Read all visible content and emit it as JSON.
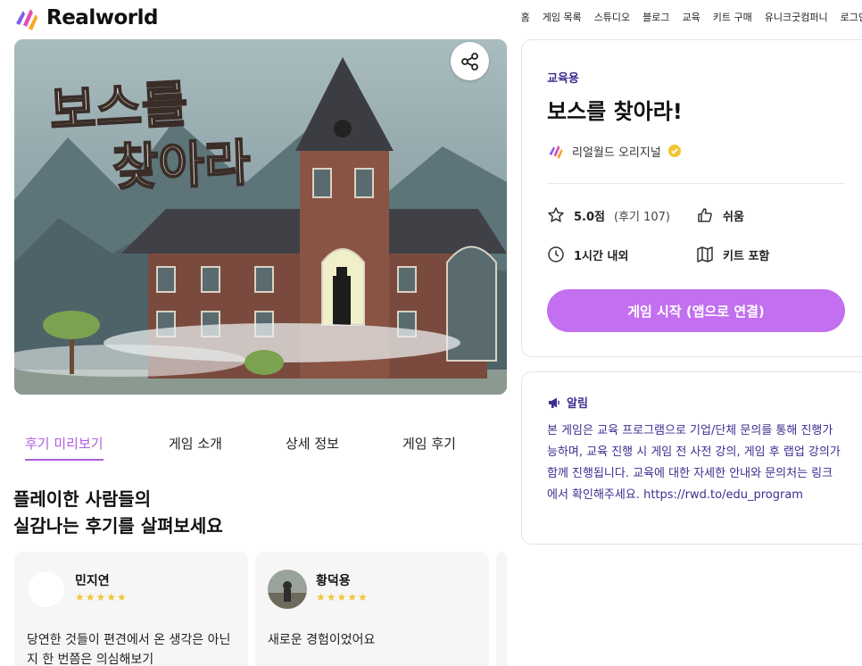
{
  "header": {
    "logo_text": "Realworld",
    "nav": [
      "홈",
      "게임 목록",
      "스튜디오",
      "블로그",
      "교육",
      "키트 구매",
      "유니크굿컴퍼니",
      "로그인"
    ]
  },
  "hero": {
    "title_line1": "보스를",
    "title_line2": "찾아라"
  },
  "tabs": [
    "후기 미리보기",
    "게임 소개",
    "상세 정보",
    "게임 후기"
  ],
  "reviews_section": {
    "heading_line1": "플레이한 사람들의",
    "heading_line2": "실감나는 후기를 살펴보세요"
  },
  "reviews": [
    {
      "name": "민지연",
      "stars": "★★★★★",
      "text": "당연한 것들이 편견에서 온 생각은 아닌지 한 번쯤은 의심해보기"
    },
    {
      "name": "황덕용",
      "stars": "★★★★★",
      "text": "새로운 경험이었어요"
    }
  ],
  "game": {
    "category": "교육용",
    "title": "보스를 찾아라!",
    "author": "리얼월드 오리지널",
    "rating": "5.0점",
    "review_count": "(후기 107)",
    "difficulty": "쉬움",
    "duration": "1시간 내외",
    "kit": "키트 포함",
    "start_button": "게임 시작 (앱으로 연결)"
  },
  "notice": {
    "title": "알림",
    "body": "본 게임은 교육 프로그램으로 기업/단체 문의를 통해 진행가능하며, 교육 진행 시 게임 전 사전 강의, 게임 후 랩업 강의가 함께 진행됩니다. 교육에 대한 자세한 안내와 문의처는 링크에서 확인해주세요. https://rwd.to/edu_program"
  },
  "colors": {
    "accent": "#c270f0",
    "accent_text": "#b05de0",
    "navy": "#3b2e8f",
    "star": "#f2c531"
  }
}
